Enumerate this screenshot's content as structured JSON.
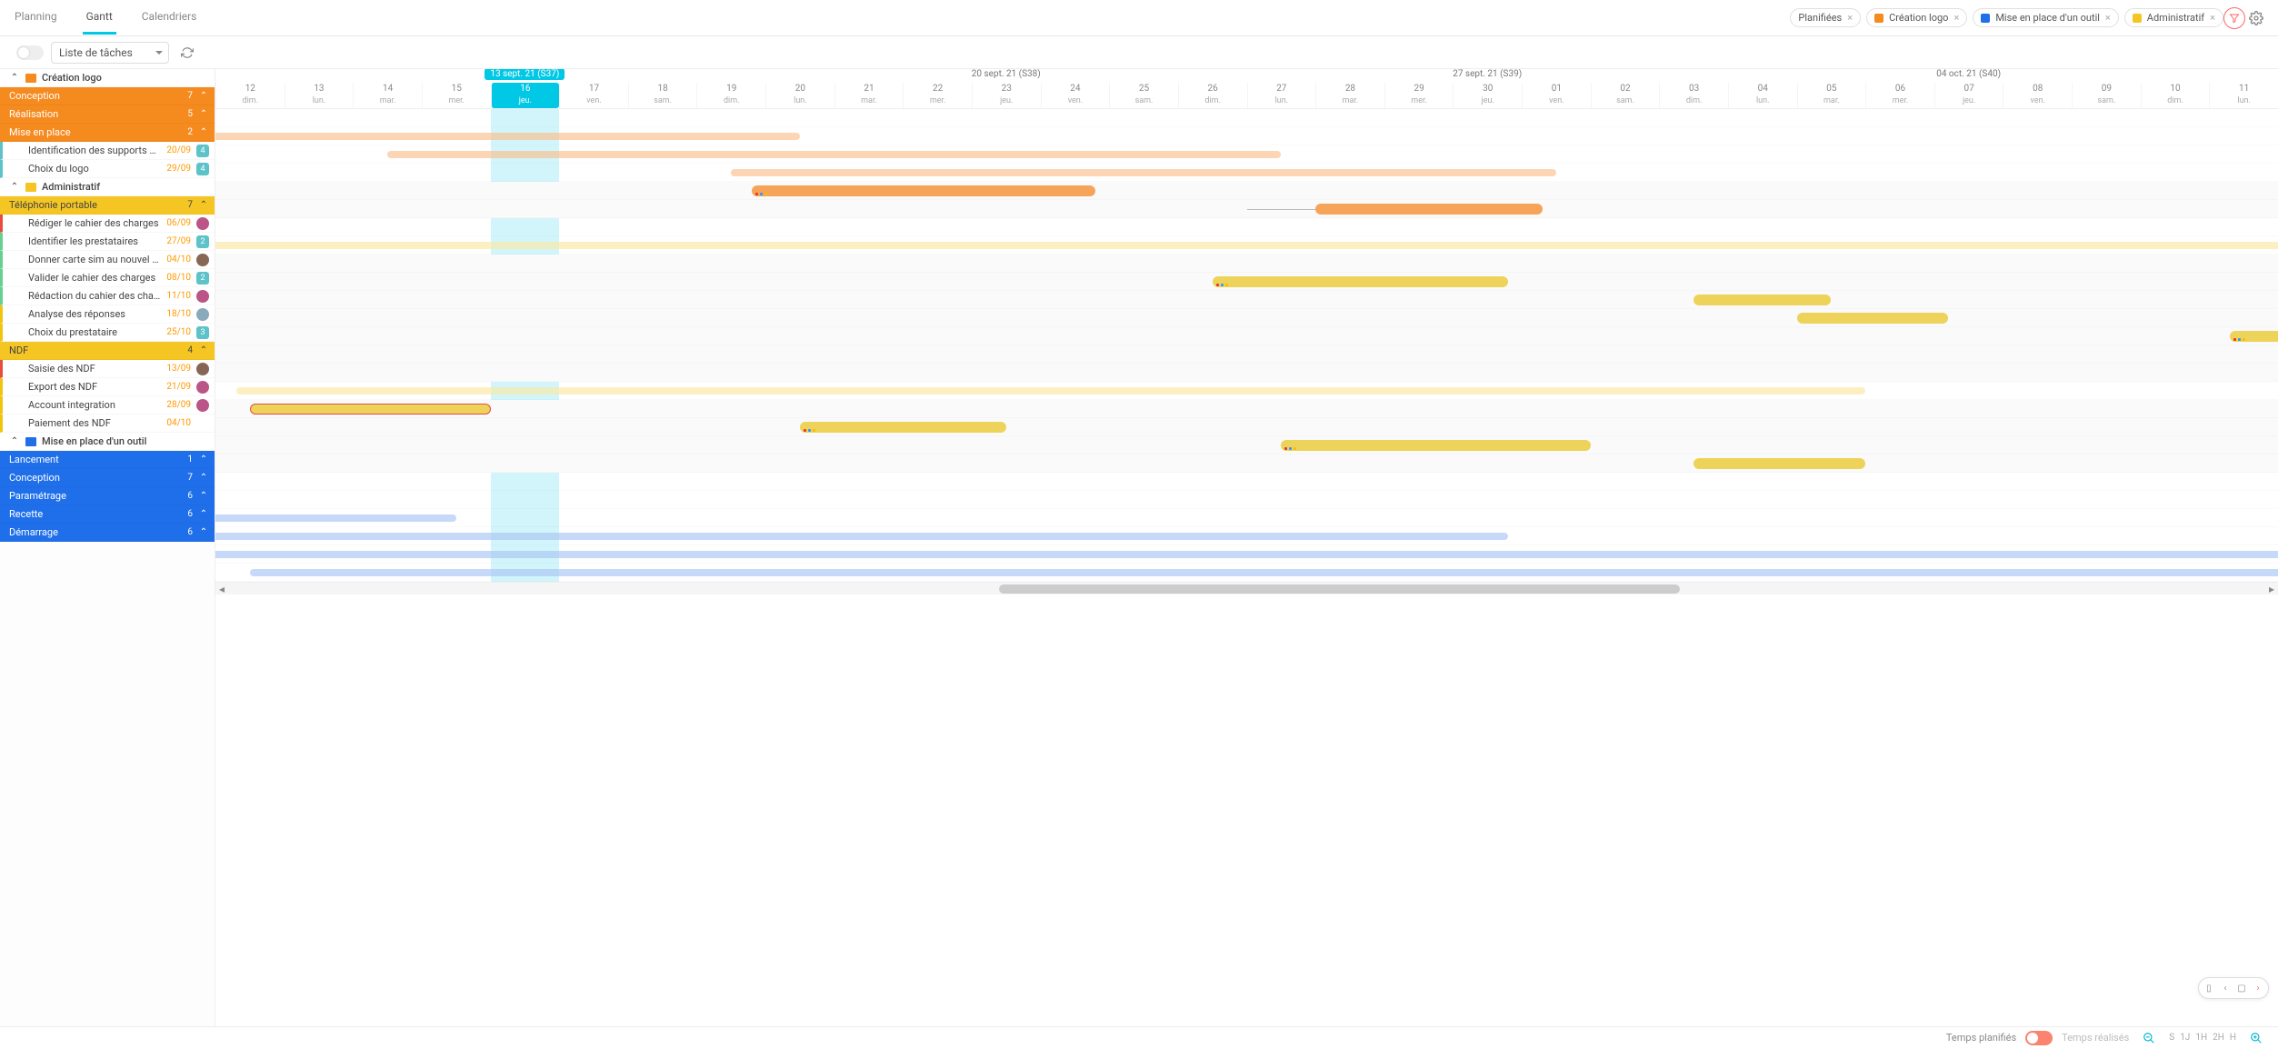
{
  "nav": {
    "tabs": [
      "Planning",
      "Gantt",
      "Calendriers"
    ],
    "active": 1
  },
  "filters": [
    {
      "label": "Planifiées",
      "color": null
    },
    {
      "label": "Création logo",
      "color": "#f58a1f"
    },
    {
      "label": "Mise en place d'un outil",
      "color": "#1f6fea"
    },
    {
      "label": "Administratif",
      "color": "#f5c623"
    }
  ],
  "toolbar": {
    "dropdown": "Liste de tâches"
  },
  "timeline": {
    "today_label": "13 sept. 21 (S37)",
    "today_index": 4,
    "weeks": [
      {
        "label": "",
        "start": 0,
        "span": 8
      },
      {
        "label": "20 sept. 21 (S38)",
        "start": 8,
        "span": 7
      },
      {
        "label": "27 sept. 21 (S39)",
        "start": 15,
        "span": 7
      },
      {
        "label": "04 oct. 21 (S40)",
        "start": 22,
        "span": 7
      }
    ],
    "days": [
      {
        "n": "12",
        "d": "dim."
      },
      {
        "n": "13",
        "d": "lun."
      },
      {
        "n": "14",
        "d": "mar."
      },
      {
        "n": "15",
        "d": "mer."
      },
      {
        "n": "16",
        "d": "jeu."
      },
      {
        "n": "17",
        "d": "ven."
      },
      {
        "n": "18",
        "d": "sam."
      },
      {
        "n": "19",
        "d": "dim."
      },
      {
        "n": "20",
        "d": "lun."
      },
      {
        "n": "21",
        "d": "mar."
      },
      {
        "n": "22",
        "d": "mer."
      },
      {
        "n": "23",
        "d": "jeu."
      },
      {
        "n": "24",
        "d": "ven."
      },
      {
        "n": "25",
        "d": "sam."
      },
      {
        "n": "26",
        "d": "dim."
      },
      {
        "n": "27",
        "d": "lun."
      },
      {
        "n": "28",
        "d": "mar."
      },
      {
        "n": "29",
        "d": "mer."
      },
      {
        "n": "30",
        "d": "jeu."
      },
      {
        "n": "01",
        "d": "ven."
      },
      {
        "n": "02",
        "d": "sam."
      },
      {
        "n": "03",
        "d": "dim."
      },
      {
        "n": "04",
        "d": "lun."
      },
      {
        "n": "05",
        "d": "mar."
      },
      {
        "n": "06",
        "d": "mer."
      },
      {
        "n": "07",
        "d": "jeu."
      },
      {
        "n": "08",
        "d": "ven."
      },
      {
        "n": "09",
        "d": "sam."
      },
      {
        "n": "10",
        "d": "dim."
      },
      {
        "n": "11",
        "d": "lun."
      }
    ]
  },
  "rows": [
    {
      "type": "proj",
      "name": "Création logo",
      "color": "#f58a1f"
    },
    {
      "type": "group",
      "name": "Conception",
      "count": "7",
      "bg": "#f58a1f",
      "bar": {
        "s": -2,
        "e": 8.5,
        "color": "#fbbf8c",
        "thin": true
      }
    },
    {
      "type": "group",
      "name": "Réalisation",
      "count": "5",
      "bg": "#f58a1f",
      "bar": {
        "s": 2.5,
        "e": 15.5,
        "color": "#fbbf8c",
        "thin": true
      }
    },
    {
      "type": "group",
      "name": "Mise en place",
      "count": "2",
      "bg": "#f58a1f",
      "bar": {
        "s": 7.5,
        "e": 19.5,
        "color": "#fbbf8c",
        "thin": true
      }
    },
    {
      "type": "task",
      "name": "Identification des supports de commun...",
      "due": "20/09",
      "badge": "4",
      "badgec": "#5ec3c9",
      "accent": "#5ec3c9",
      "bar": {
        "s": 7.8,
        "e": 12.8,
        "color": "#f7a45b",
        "marks": true
      }
    },
    {
      "type": "task",
      "name": "Choix du logo",
      "due": "29/09",
      "badge": "4",
      "badgec": "#5ec3c9",
      "accent": "#5ec3c9",
      "bar": {
        "s": 16,
        "e": 19.3,
        "color": "#f7a45b",
        "lead": 15
      }
    },
    {
      "type": "proj",
      "name": "Administratif",
      "color": "#f5c623"
    },
    {
      "type": "group",
      "name": "Téléphonie portable",
      "count": "7",
      "bg": "#f5c623",
      "fg": "#444",
      "bar": {
        "s": -2,
        "e": 32,
        "color": "#fbe8a2",
        "thin": true
      }
    },
    {
      "type": "task",
      "name": "Rédiger le cahier des charges",
      "due": "06/09",
      "avatar": "#b58",
      "accent": "#e84c3d"
    },
    {
      "type": "task",
      "name": "Identifier les prestataires",
      "due": "27/09",
      "badge": "2",
      "badgec": "#5ec3c9",
      "accent": "#66d18f",
      "bar": {
        "s": 14.5,
        "e": 18.8,
        "color": "#edd35a",
        "marks": true
      }
    },
    {
      "type": "task",
      "name": "Donner carte sim au nouvel arrivant",
      "due": "04/10",
      "avatar": "#865",
      "accent": "#66d18f",
      "bar": {
        "s": 21.5,
        "e": 23.5,
        "color": "#edd35a"
      }
    },
    {
      "type": "task",
      "name": "Valider le cahier des charges",
      "due": "08/10",
      "badge": "2",
      "badgec": "#5ec3c9",
      "accent": "#66d18f",
      "bar": {
        "s": 23,
        "e": 25.2,
        "color": "#edd35a"
      }
    },
    {
      "type": "task",
      "name": "Rédaction du cahier des charges",
      "due": "11/10",
      "avatar": "#b58",
      "accent": "#66d18f",
      "bar": {
        "s": 29.3,
        "e": 32,
        "color": "#edd35a",
        "marks": true
      }
    },
    {
      "type": "task",
      "name": "Analyse des réponses",
      "due": "18/10",
      "avatar": "#8ab",
      "accent": "#f1c40e"
    },
    {
      "type": "task",
      "name": "Choix du prestataire",
      "due": "25/10",
      "badge": "3",
      "badgec": "#5ec3c9",
      "accent": "#f1c40e"
    },
    {
      "type": "group",
      "name": "NDF",
      "count": "4",
      "bg": "#f5c623",
      "fg": "#444",
      "bar": {
        "s": 0.3,
        "e": 24,
        "color": "#fbe8a2",
        "thin": true
      }
    },
    {
      "type": "task",
      "name": "Saisie des NDF",
      "due": "13/09",
      "avatar": "#865",
      "accent": "#e84c3d",
      "bar": {
        "s": 0.5,
        "e": 4,
        "color": "#edd35a",
        "border": "#e84c3d"
      }
    },
    {
      "type": "task",
      "name": "Export des NDF",
      "due": "21/09",
      "avatar": "#b58",
      "accent": "#f1c40e",
      "bar": {
        "s": 8.5,
        "e": 11.5,
        "color": "#edd35a",
        "marks": true
      }
    },
    {
      "type": "task",
      "name": "Account integration",
      "due": "28/09",
      "avatar": "#b58",
      "accent": "#f1c40e",
      "bar": {
        "s": 15.5,
        "e": 20,
        "color": "#edd35a",
        "marks": true
      }
    },
    {
      "type": "task",
      "name": "Paiement des NDF",
      "due": "04/10",
      "accent": "#f1c40e",
      "bar": {
        "s": 21.5,
        "e": 24,
        "color": "#edd35a"
      }
    },
    {
      "type": "proj",
      "name": "Mise en place d'un outil",
      "color": "#1f6fea"
    },
    {
      "type": "group",
      "name": "Lancement",
      "count": "1",
      "bg": "#1f6fea"
    },
    {
      "type": "group",
      "name": "Conception",
      "count": "7",
      "bg": "#1f6fea",
      "bar": {
        "s": -2,
        "e": 3.5,
        "color": "#a9c4f5",
        "thin": true
      }
    },
    {
      "type": "group",
      "name": "Paramétrage",
      "count": "6",
      "bg": "#1f6fea",
      "bar": {
        "s": -2,
        "e": 18.8,
        "color": "#a9c4f5",
        "thin": true
      }
    },
    {
      "type": "group",
      "name": "Recette",
      "count": "6",
      "bg": "#1f6fea",
      "bar": {
        "s": -2,
        "e": 32,
        "color": "#a9c4f5",
        "thin": true
      }
    },
    {
      "type": "group",
      "name": "Démarrage",
      "count": "6",
      "bg": "#1f6fea",
      "bar": {
        "s": 0.5,
        "e": 32,
        "color": "#a9c4f5",
        "thin": true
      }
    }
  ],
  "footer": {
    "left_label": "Temps planifiés",
    "right_label": "Temps réalisés",
    "zoom": [
      "S",
      "1J",
      "1H",
      "2H",
      "H"
    ]
  },
  "chart_data": {
    "type": "gantt",
    "title": "Gantt",
    "x_start": "2021-09-12",
    "x_end": "2021-10-11",
    "today": "2021-09-16",
    "projects": [
      {
        "name": "Création logo",
        "color": "#f58a1f",
        "groups": [
          {
            "name": "Conception",
            "count": 7,
            "start": "2021-09-10",
            "end": "2021-09-20"
          },
          {
            "name": "Réalisation",
            "count": 5,
            "start": "2021-09-14",
            "end": "2021-09-27"
          },
          {
            "name": "Mise en place",
            "count": 2,
            "start": "2021-09-19",
            "end": "2021-10-01",
            "tasks": [
              {
                "name": "Identification des supports de communication",
                "due": "2021-09-20",
                "start": "2021-09-20",
                "end": "2021-09-24"
              },
              {
                "name": "Choix du logo",
                "due": "2021-09-29",
                "start": "2021-09-28",
                "end": "2021-10-01"
              }
            ]
          }
        ]
      },
      {
        "name": "Administratif",
        "color": "#f5c623",
        "groups": [
          {
            "name": "Téléphonie portable",
            "count": 7,
            "tasks": [
              {
                "name": "Rédiger le cahier des charges",
                "due": "2021-09-06"
              },
              {
                "name": "Identifier les prestataires",
                "due": "2021-09-27",
                "start": "2021-09-26",
                "end": "2021-09-30"
              },
              {
                "name": "Donner carte sim au nouvel arrivant",
                "due": "2021-10-04",
                "start": "2021-10-03",
                "end": "2021-10-05"
              },
              {
                "name": "Valider le cahier des charges",
                "due": "2021-10-08",
                "start": "2021-10-05",
                "end": "2021-10-07"
              },
              {
                "name": "Rédaction du cahier des charges",
                "due": "2021-10-11",
                "start": "2021-10-11",
                "end": "2021-10-13"
              },
              {
                "name": "Analyse des réponses",
                "due": "2021-10-18"
              },
              {
                "name": "Choix du prestataire",
                "due": "2021-10-25"
              }
            ]
          },
          {
            "name": "NDF",
            "count": 4,
            "tasks": [
              {
                "name": "Saisie des NDF",
                "due": "2021-09-13",
                "start": "2021-09-12",
                "end": "2021-09-16"
              },
              {
                "name": "Export des NDF",
                "due": "2021-09-21",
                "start": "2021-09-20",
                "end": "2021-09-23"
              },
              {
                "name": "Account integration",
                "due": "2021-09-28",
                "start": "2021-09-27",
                "end": "2021-10-01"
              },
              {
                "name": "Paiement des NDF",
                "due": "2021-10-04",
                "start": "2021-10-03",
                "end": "2021-10-05"
              }
            ]
          }
        ]
      },
      {
        "name": "Mise en place d'un outil",
        "color": "#1f6fea",
        "groups": [
          {
            "name": "Lancement",
            "count": 1
          },
          {
            "name": "Conception",
            "count": 7,
            "end": "2021-09-15"
          },
          {
            "name": "Paramétrage",
            "count": 6,
            "end": "2021-09-30"
          },
          {
            "name": "Recette",
            "count": 6
          },
          {
            "name": "Démarrage",
            "count": 6,
            "start": "2021-09-12"
          }
        ]
      }
    ]
  }
}
